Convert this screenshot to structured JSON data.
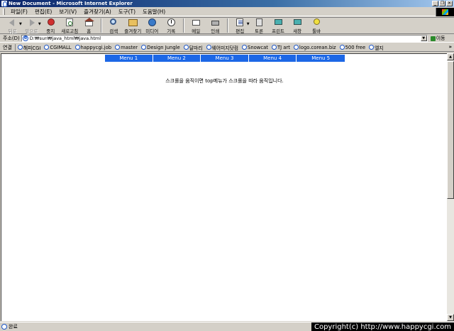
{
  "window": {
    "title": "New Document - Microsoft Internet Explorer",
    "min_label": "_",
    "max_label": "❐",
    "close_label": "✕"
  },
  "menubar": {
    "items": [
      "파일(F)",
      "편집(E)",
      "보기(V)",
      "즐겨찾기(A)",
      "도구(T)",
      "도움말(H)"
    ]
  },
  "toolbar": {
    "back": "뒤로",
    "forward": "앞으로",
    "stop": "중지",
    "refresh": "새로고침",
    "home": "홈",
    "search": "검색",
    "favorites": "즐겨찾기",
    "media": "미디어",
    "history": "기록",
    "mail": "메일",
    "print": "인쇄",
    "edit": "편집",
    "discuss": "토론",
    "pc": "프린트",
    "messenger_a": "새창",
    "messenger_b": "툴바"
  },
  "address": {
    "label": "주소(D)",
    "value": "D:₩sun₩java_html₩java.html",
    "go_label": "이동"
  },
  "links": {
    "label": "연결",
    "items": [
      "해피CGI",
      "CGIMALL",
      "happycgi.job",
      "master",
      "Design Jungle",
      "달마리",
      "웨어미지닷컴",
      "Snowcat",
      "TJ art",
      "logo.corean.biz",
      "500 free",
      "엘지"
    ],
    "more": "»"
  },
  "page": {
    "top_menu": [
      "Menu 1",
      "Menu 2",
      "Menu 3",
      "Menu 4",
      "Menu 5"
    ],
    "message": "스크롤을 움직이면 top메뉴가 스크롤을 따라 움직입니다.",
    "menu_color": "#1c67e6"
  },
  "scrollbar": {
    "up": "▲",
    "down": "▼"
  },
  "status": {
    "text": "완료",
    "copyright": "Copyright(c) http://www.happycgi.com"
  }
}
